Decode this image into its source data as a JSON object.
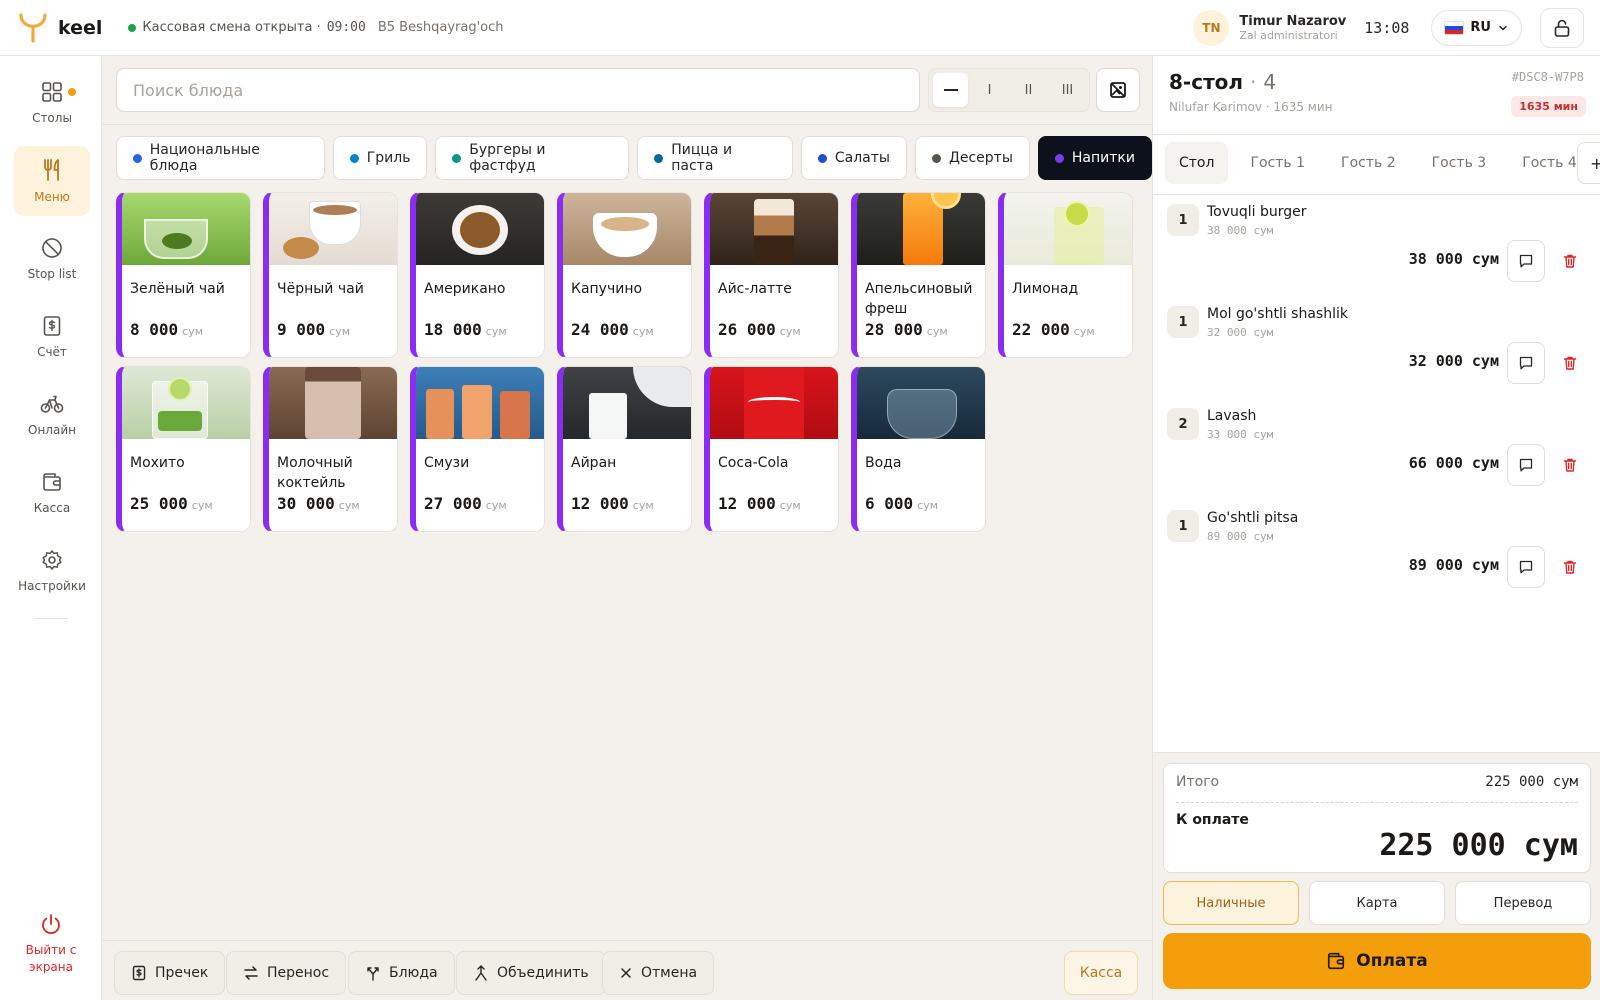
{
  "app": {
    "logo_text": "keel",
    "shift_status": "Кассовая смена открыта ·",
    "shift_time": "09:00",
    "branch": "B5 Beshqayrag'och",
    "user_initials": "TN",
    "user_name": "Timur Nazarov",
    "user_role": "Zal administratori",
    "clock": "13:08",
    "language": "RU"
  },
  "sidebar": {
    "items": [
      {
        "label": "Столы",
        "icon": "grid-icon"
      },
      {
        "label": "Меню",
        "icon": "fork-knife-icon"
      },
      {
        "label": "Stop list",
        "icon": "ban-icon"
      },
      {
        "label": "Счёт",
        "icon": "receipt-icon"
      },
      {
        "label": "Онлайн",
        "icon": "bicycle-icon"
      },
      {
        "label": "Касса",
        "icon": "wallet-icon"
      },
      {
        "label": "Настройки",
        "icon": "gear-icon"
      }
    ],
    "logout_label": "Выйти с экрана"
  },
  "menu": {
    "search_placeholder": "Поиск блюда",
    "size_options": [
      "—",
      "I",
      "II",
      "III"
    ],
    "categories": [
      {
        "label": "Национальные блюда",
        "color": "#2563eb"
      },
      {
        "label": "Гриль",
        "color": "#0284c7"
      },
      {
        "label": "Бургеры и фастфуд",
        "color": "#0d9488"
      },
      {
        "label": "Пицца и паста",
        "color": "#0369a1"
      },
      {
        "label": "Салаты",
        "color": "#1d4ed8"
      },
      {
        "label": "Десерты",
        "color": "#57534e"
      },
      {
        "label": "Напитки",
        "color": "#7c3aed"
      }
    ],
    "currency": "сум",
    "items": [
      {
        "name": "Зелёный чай",
        "price": "8 000"
      },
      {
        "name": "Чёрный чай",
        "price": "9 000"
      },
      {
        "name": "Американо",
        "price": "18 000"
      },
      {
        "name": "Капучино",
        "price": "24 000"
      },
      {
        "name": "Айс-латте",
        "price": "26 000"
      },
      {
        "name": "Апельсиновый фреш",
        "price": "28 000"
      },
      {
        "name": "Лимонад",
        "price": "22 000"
      },
      {
        "name": "Мохито",
        "price": "25 000"
      },
      {
        "name": "Молочный коктейль",
        "price": "30 000"
      },
      {
        "name": "Смузи",
        "price": "27 000"
      },
      {
        "name": "Айран",
        "price": "12 000"
      },
      {
        "name": "Coca-Cola",
        "price": "12 000"
      },
      {
        "name": "Вода",
        "price": "6 000"
      }
    ]
  },
  "actions": {
    "precheck": "Пречек",
    "transfer": "Перенос",
    "dishes": "Блюда",
    "merge": "Объединить",
    "cancel": "Отмена",
    "kassa": "Касса"
  },
  "order": {
    "table_title": "8-стол",
    "title_sep": "·",
    "guests": "4",
    "order_id": "#DSC8-W7P8",
    "waiter_line": "Nilufar Karimov · 1635 мин",
    "timer": "1635 мин",
    "guest_tabs": [
      "Стол",
      "Гость 1",
      "Гость 2",
      "Гость 3",
      "Гость 4"
    ],
    "add_guest": "+",
    "items": [
      {
        "qty": "1",
        "name": "Tovuqli burger",
        "unit": "38 000 сум",
        "total": "38 000 сум"
      },
      {
        "qty": "1",
        "name": "Mol go'shtli shashlik",
        "unit": "32 000 сум",
        "total": "32 000 сум"
      },
      {
        "qty": "2",
        "name": "Lavash",
        "unit": "33 000 сум",
        "total": "66 000 сум"
      },
      {
        "qty": "1",
        "name": "Go'shtli pitsa",
        "unit": "89 000 сум",
        "total": "89 000 сум"
      }
    ],
    "subtotal_label": "Итого",
    "subtotal_value": "225 000 сум",
    "pay_label": "К оплате",
    "pay_value": "225 000 сум",
    "pay_methods": [
      "Наличные",
      "Карта",
      "Перевод"
    ],
    "pay_button": "Оплата"
  },
  "colors": {
    "accent": "#f59e0b",
    "drinks": "#8b2cf5",
    "danger": "#dc2626"
  }
}
